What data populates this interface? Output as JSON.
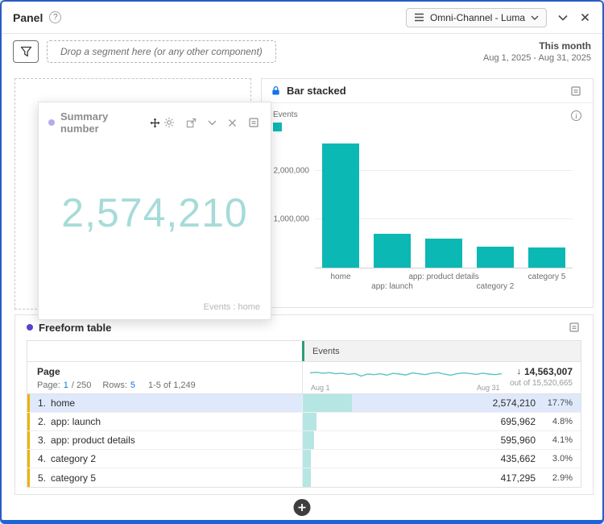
{
  "header": {
    "title": "Panel",
    "help_glyph": "?",
    "dataset": "Omni-Channel - Luma"
  },
  "toolbar": {
    "drop_hint": "Drop a segment here (or any other component)",
    "range_label": "This month",
    "range_dates": "Aug 1, 2025 - Aug 31, 2025"
  },
  "summary_card": {
    "title": "Summary number",
    "value": "2,574,210",
    "caption": "Events : home"
  },
  "bar_card": {
    "title": "Bar stacked",
    "legend_label": "Events",
    "info_glyph": "i"
  },
  "chart_data": [
    {
      "type": "bar",
      "title": "Bar stacked",
      "legend": [
        "Events"
      ],
      "legend_position": "top-left",
      "categories": [
        "home",
        "app: launch",
        "app: product details",
        "category 2",
        "category 5"
      ],
      "values": [
        2574210,
        695962,
        595960,
        435662,
        417295
      ],
      "yticks": [
        {
          "label": "1,000,000",
          "value": 1000000
        },
        {
          "label": "2,000,000",
          "value": 2000000
        }
      ],
      "ylim": [
        0,
        2800000
      ],
      "grid": true,
      "bar_color": "#0bb8b4"
    },
    {
      "type": "line",
      "name": "events-daily-sparkline",
      "x_start_label": "Aug 1",
      "x_end_label": "Aug 31",
      "line_color": "#5bc4bf",
      "normalized_points": [
        0.58,
        0.62,
        0.55,
        0.6,
        0.52,
        0.56,
        0.48,
        0.54,
        0.36,
        0.5,
        0.46,
        0.52,
        0.42,
        0.55,
        0.5,
        0.44,
        0.58,
        0.52,
        0.46,
        0.55,
        0.6,
        0.5,
        0.42,
        0.52,
        0.58,
        0.54,
        0.48,
        0.56,
        0.5,
        0.46,
        0.52
      ]
    }
  ],
  "freeform_table": {
    "title": "Freeform table",
    "column_header": "Events",
    "dimension_header": "Page",
    "pagination": {
      "page_label": "Page:",
      "page_value": "1",
      "page_total": "/ 250",
      "rows_label": "Rows:",
      "rows_value": "5",
      "range": "1-5 of 1,249"
    },
    "sort_icon": "↓",
    "total_value": "14,563,007",
    "total_out_of": "out of 15,520,665",
    "spark_start": "Aug 1",
    "spark_end": "Aug 31",
    "rows": [
      {
        "index": "1.",
        "name": "home",
        "value": "2,574,210",
        "pct": "17.7%",
        "bar_pct": 17.7,
        "selected": true
      },
      {
        "index": "2.",
        "name": "app: launch",
        "value": "695,962",
        "pct": "4.8%",
        "bar_pct": 4.8,
        "selected": false
      },
      {
        "index": "3.",
        "name": "app: product details",
        "value": "595,960",
        "pct": "4.1%",
        "bar_pct": 4.1,
        "selected": false
      },
      {
        "index": "4.",
        "name": "category 2",
        "value": "435,662",
        "pct": "3.0%",
        "bar_pct": 3.0,
        "selected": false
      },
      {
        "index": "5.",
        "name": "category 5",
        "value": "417,295",
        "pct": "2.9%",
        "bar_pct": 2.9,
        "selected": false
      }
    ]
  },
  "colors": {
    "accent_blue": "#1473e6",
    "bar_teal": "#0bb8b4",
    "summary_number_teal": "#a6dbd8",
    "cell_bar_teal": "#b6e6e3",
    "row_accent_yellow": "#ecb200",
    "column_accent_green": "#2d9d78",
    "selected_row_blue": "#dfe9fb",
    "panel_border_blue": "#1c63d9"
  }
}
